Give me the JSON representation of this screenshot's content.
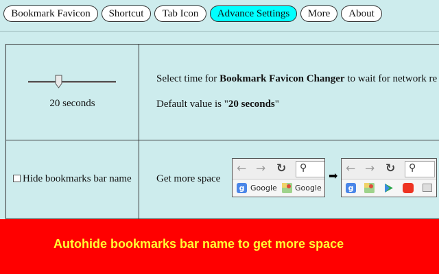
{
  "tabs": [
    {
      "label": "Bookmark Favicon",
      "active": false
    },
    {
      "label": "Shortcut",
      "active": false
    },
    {
      "label": "Tab Icon",
      "active": false
    },
    {
      "label": "Advance Settings",
      "active": true
    },
    {
      "label": "More",
      "active": false
    },
    {
      "label": "About",
      "active": false
    }
  ],
  "settings": {
    "wait_time": {
      "slider_label": "20 seconds",
      "slider_fraction": 0.33,
      "desc_prefix": "Select time for ",
      "desc_app_name": "Bookmark Favicon Changer",
      "desc_suffix": " to wait for network re",
      "default_prefix": "Default value is \"",
      "default_value": "20 seconds",
      "default_suffix": "\""
    },
    "hide_names": {
      "checkbox_label": "Hide bookmarks bar name",
      "checked": false,
      "description": "Get more space",
      "preview_before": {
        "bookmarks": [
          "Google",
          "Google M"
        ]
      }
    }
  },
  "banner": {
    "text": "Autohide bookmarks bar name to get more space",
    "background": "#ff0000",
    "text_color": "#ffff33"
  },
  "colors": {
    "page_background": "#cdeced",
    "active_tab": "#00ffff",
    "tab": "#ffffff"
  },
  "icons": [
    "back-arrow-icon",
    "forward-arrow-icon",
    "reload-icon",
    "search-icon",
    "google-icon",
    "maps-icon",
    "play-store-icon",
    "youtube-icon",
    "right-arrow-icon"
  ]
}
